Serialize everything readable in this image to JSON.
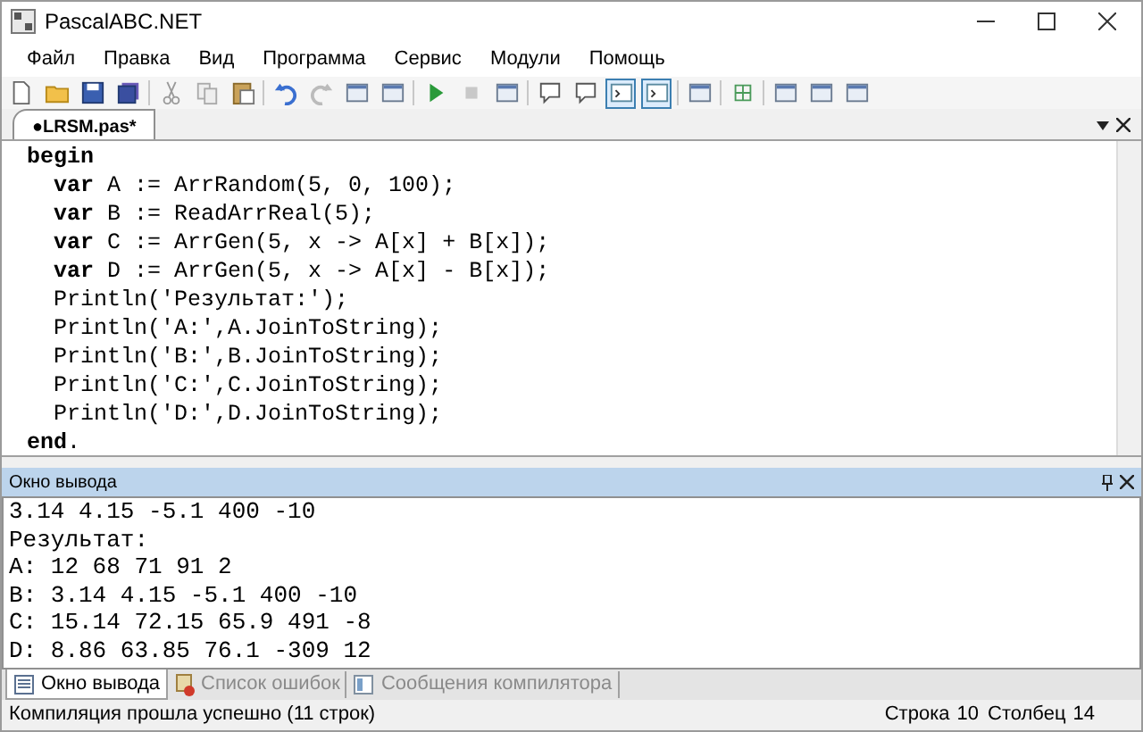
{
  "window": {
    "title": "PascalABC.NET"
  },
  "menu": [
    "Файл",
    "Правка",
    "Вид",
    "Программа",
    "Сервис",
    "Модули",
    "Помощь"
  ],
  "toolbar": [
    [
      {
        "kind": "new",
        "pressed": false
      },
      {
        "kind": "open",
        "pressed": false
      },
      {
        "kind": "save",
        "pressed": false
      },
      {
        "kind": "saveall",
        "pressed": false
      }
    ],
    [
      {
        "kind": "cut",
        "pressed": false
      },
      {
        "kind": "copy",
        "pressed": false
      },
      {
        "kind": "paste",
        "pressed": false
      }
    ],
    [
      {
        "kind": "undo",
        "pressed": false
      },
      {
        "kind": "redo",
        "pressed": false
      },
      {
        "kind": "window",
        "pressed": false
      },
      {
        "kind": "window",
        "pressed": false
      }
    ],
    [
      {
        "kind": "run",
        "pressed": false
      },
      {
        "kind": "stop",
        "pressed": false
      },
      {
        "kind": "window",
        "pressed": false
      }
    ],
    [
      {
        "kind": "comment",
        "pressed": false
      },
      {
        "kind": "comment",
        "pressed": false
      },
      {
        "kind": "console",
        "pressed": true
      },
      {
        "kind": "console",
        "pressed": true
      }
    ],
    [
      {
        "kind": "window",
        "pressed": false
      }
    ],
    [
      {
        "kind": "grid",
        "pressed": false
      }
    ],
    [
      {
        "kind": "window",
        "pressed": false
      },
      {
        "kind": "window",
        "pressed": false
      },
      {
        "kind": "window",
        "pressed": false
      }
    ]
  ],
  "tabs": [
    {
      "label": "●LRSM.pas*",
      "selected": true
    }
  ],
  "editor": {
    "lines": [
      "**begin**",
      "  **var** A := ArrRandom(5, 0, 100);",
      "  **var** B := ReadArrReal(5);",
      "  **var** C := ArrGen(5, x -> A[x] + B[x]);",
      "  **var** D := ArrGen(5, x -> A[x] - B[x]);",
      "  Println('Результат:');",
      "  Println('A:',A.JoinToString);",
      "  Println('B:',B.JoinToString);",
      "  Println('C:',C.JoinToString);",
      "  Println('D:',D.JoinToString);",
      "**end**."
    ]
  },
  "output_panel": {
    "title": "Окно вывода",
    "lines": [
      "3.14 4.15 -5.1 400 -10",
      "Результат:",
      "A: 12 68 71 91 2",
      "B: 3.14 4.15 -5.1 400 -10",
      "C: 15.14 72.15 65.9 491 -8",
      "D: 8.86 63.85 76.1 -309 12"
    ]
  },
  "bottom_tabs": [
    {
      "label": "Окно вывода",
      "selected": true,
      "kind": "output"
    },
    {
      "label": "Список ошибок",
      "selected": false,
      "kind": "errors"
    },
    {
      "label": "Сообщения компилятора",
      "selected": false,
      "kind": "messages"
    }
  ],
  "status_bar": {
    "message": "Компиляция прошла успешно (11 строк)",
    "row_label": "Строка",
    "row": "10",
    "col_label": "Столбец",
    "col": "14"
  }
}
